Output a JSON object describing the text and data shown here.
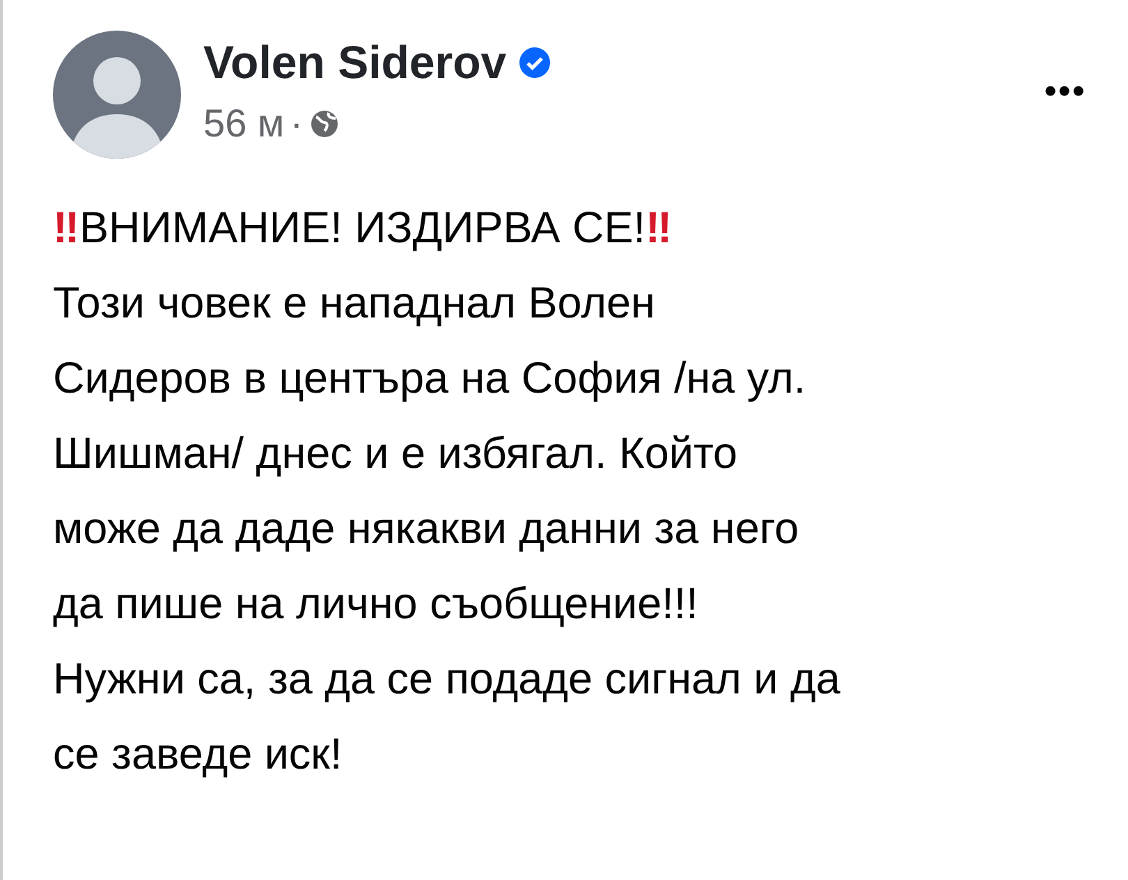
{
  "post": {
    "author": "Volen Siderov",
    "verified": true,
    "time": "56 м",
    "separator": "·",
    "menu": "•••",
    "headline": {
      "mark_left": "‼",
      "text": "ВНИМАНИЕ! ИЗДИРВА СЕ!",
      "mark_right": "‼"
    },
    "lines": [
      "Този човек е нападнал Волен",
      "Сидеров в центъра на София /на ул.",
      "Шишман/ днес и е избягал. Който",
      "може да даде някакви данни за него",
      "да пише на лично съобщение!!!",
      "Нужни са, за да се подаде сигнал и да",
      "се заведе иск!"
    ]
  }
}
